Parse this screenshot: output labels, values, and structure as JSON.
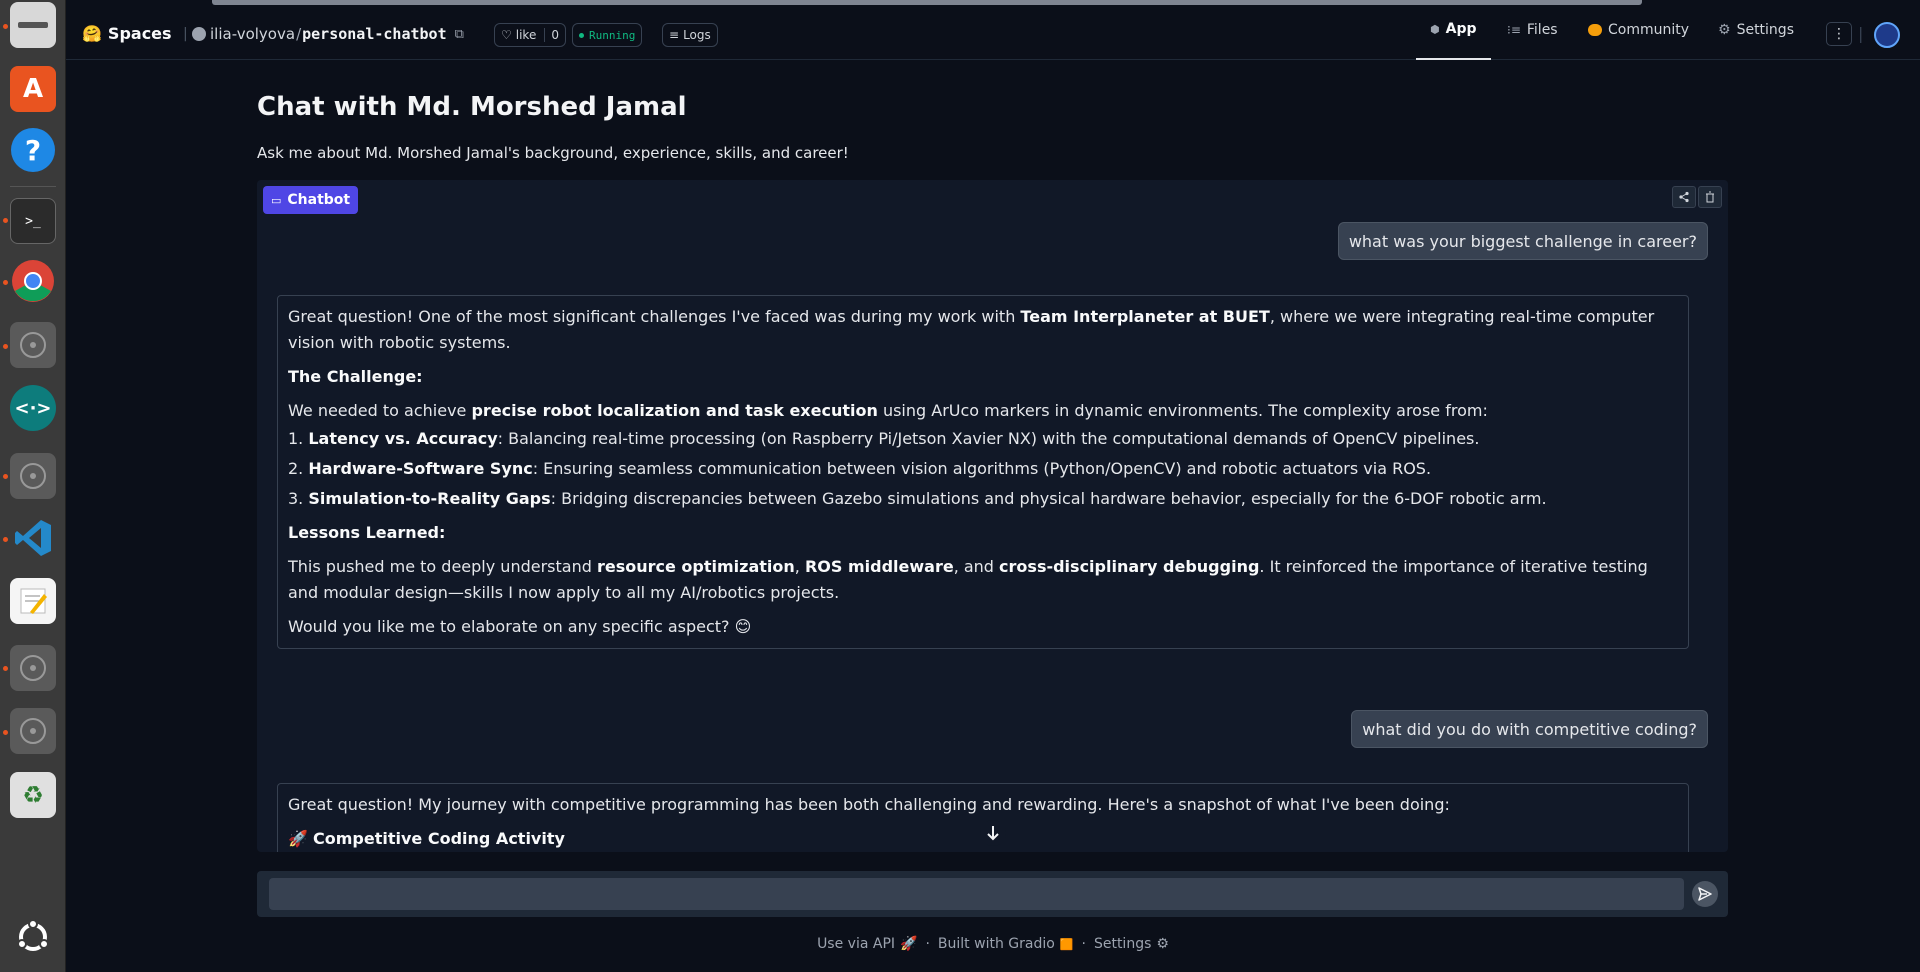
{
  "header": {
    "spaces_label": "Spaces",
    "owner": "ilia-volyova",
    "slash": "/",
    "repo": "personal-chatbot",
    "like_label": "like",
    "like_count": "0",
    "status": "Running",
    "logs_label": "Logs",
    "tabs": [
      {
        "label": "App",
        "icon": "app-icon"
      },
      {
        "label": "Files",
        "icon": "files-icon"
      },
      {
        "label": "Community",
        "icon": "community-icon"
      },
      {
        "label": "Settings",
        "icon": "gear-icon"
      }
    ]
  },
  "page": {
    "title": "Chat with Md. Morshed Jamal",
    "subtitle": "Ask me about Md. Morshed Jamal's background, experience, skills, and career!"
  },
  "chatbot": {
    "label": "Chatbot",
    "messages": {
      "user1": "what was your biggest challenge in career?",
      "bot1": {
        "p1_a": "Great question! One of the most significant challenges I've faced was during my work with ",
        "p1_b": "Team Interplaneter at BUET",
        "p1_c": ", where we were integrating real-time computer vision with robotic systems.",
        "h1": "The Challenge:",
        "p2_a": "We needed to achieve ",
        "p2_b": "precise robot localization and task execution",
        "p2_c": " using ArUco markers in dynamic environments. The complexity arose from:",
        "li1_num": "1.",
        "li1_b": "Latency vs. Accuracy",
        "li1_t": ": Balancing real-time processing (on Raspberry Pi/Jetson Xavier NX) with the computational demands of OpenCV pipelines.",
        "li2_num": "2.",
        "li2_b": "Hardware-Software Sync",
        "li2_t": ": Ensuring seamless communication between vision algorithms (Python/OpenCV) and robotic actuators via ROS.",
        "li3_num": "3.",
        "li3_b": "Simulation-to-Reality Gaps",
        "li3_t": ": Bridging discrepancies between Gazebo simulations and physical hardware behavior, especially for the 6-DOF robotic arm.",
        "h2": "Lessons Learned:",
        "p3_a": "This pushed me to deeply understand ",
        "p3_b": "resource optimization",
        "p3_c": ", ",
        "p3_d": "ROS middleware",
        "p3_e": ", and ",
        "p3_f": "cross-disciplinary debugging",
        "p3_g": ". It reinforced the importance of iterative testing and modular design—skills I now apply to all my AI/robotics projects.",
        "p4": "Would you like me to elaborate on any specific aspect? 😊"
      },
      "user2": "what did you do with competitive coding?",
      "bot2": {
        "p1": "Great question! My journey with competitive programming has been both challenging and rewarding. Here's a snapshot of what I've been doing:",
        "h1_icon": "🚀",
        "h1": "Competitive Coding Activity"
      }
    }
  },
  "input": {
    "value": "",
    "placeholder": ""
  },
  "footer": {
    "api": "Use via API",
    "api_icon": "🚀",
    "built": "Built with Gradio",
    "built_icon": "🟧",
    "settings": "Settings",
    "settings_icon": "⚙",
    "dot": "·"
  },
  "colors": {
    "accent": "#4f46e5",
    "running": "#10b981",
    "background": "#0b0f19"
  }
}
